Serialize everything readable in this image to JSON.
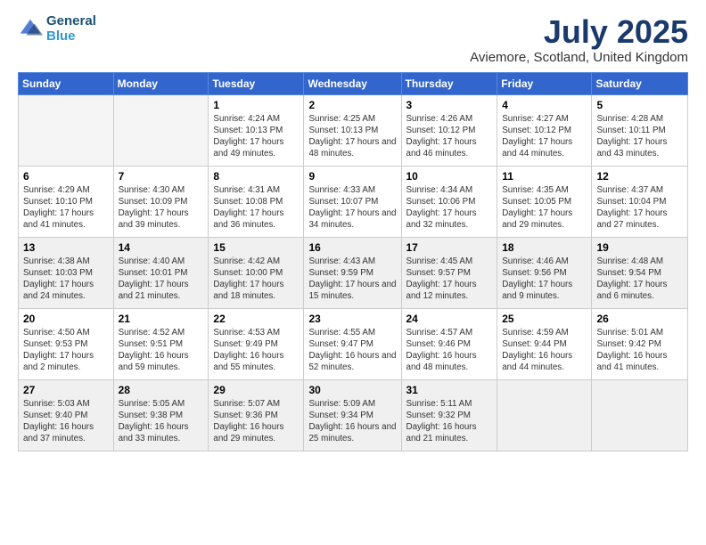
{
  "logo": {
    "line1": "General",
    "line2": "Blue"
  },
  "title": "July 2025",
  "location": "Aviemore, Scotland, United Kingdom",
  "days_of_week": [
    "Sunday",
    "Monday",
    "Tuesday",
    "Wednesday",
    "Thursday",
    "Friday",
    "Saturday"
  ],
  "weeks": [
    [
      {
        "day": "",
        "info": "",
        "empty": true
      },
      {
        "day": "",
        "info": "",
        "empty": true
      },
      {
        "day": "1",
        "info": "Sunrise: 4:24 AM\nSunset: 10:13 PM\nDaylight: 17 hours and 49 minutes."
      },
      {
        "day": "2",
        "info": "Sunrise: 4:25 AM\nSunset: 10:13 PM\nDaylight: 17 hours and 48 minutes."
      },
      {
        "day": "3",
        "info": "Sunrise: 4:26 AM\nSunset: 10:12 PM\nDaylight: 17 hours and 46 minutes."
      },
      {
        "day": "4",
        "info": "Sunrise: 4:27 AM\nSunset: 10:12 PM\nDaylight: 17 hours and 44 minutes."
      },
      {
        "day": "5",
        "info": "Sunrise: 4:28 AM\nSunset: 10:11 PM\nDaylight: 17 hours and 43 minutes."
      }
    ],
    [
      {
        "day": "6",
        "info": "Sunrise: 4:29 AM\nSunset: 10:10 PM\nDaylight: 17 hours and 41 minutes."
      },
      {
        "day": "7",
        "info": "Sunrise: 4:30 AM\nSunset: 10:09 PM\nDaylight: 17 hours and 39 minutes."
      },
      {
        "day": "8",
        "info": "Sunrise: 4:31 AM\nSunset: 10:08 PM\nDaylight: 17 hours and 36 minutes."
      },
      {
        "day": "9",
        "info": "Sunrise: 4:33 AM\nSunset: 10:07 PM\nDaylight: 17 hours and 34 minutes."
      },
      {
        "day": "10",
        "info": "Sunrise: 4:34 AM\nSunset: 10:06 PM\nDaylight: 17 hours and 32 minutes."
      },
      {
        "day": "11",
        "info": "Sunrise: 4:35 AM\nSunset: 10:05 PM\nDaylight: 17 hours and 29 minutes."
      },
      {
        "day": "12",
        "info": "Sunrise: 4:37 AM\nSunset: 10:04 PM\nDaylight: 17 hours and 27 minutes."
      }
    ],
    [
      {
        "day": "13",
        "info": "Sunrise: 4:38 AM\nSunset: 10:03 PM\nDaylight: 17 hours and 24 minutes.",
        "shaded": true
      },
      {
        "day": "14",
        "info": "Sunrise: 4:40 AM\nSunset: 10:01 PM\nDaylight: 17 hours and 21 minutes.",
        "shaded": true
      },
      {
        "day": "15",
        "info": "Sunrise: 4:42 AM\nSunset: 10:00 PM\nDaylight: 17 hours and 18 minutes.",
        "shaded": true
      },
      {
        "day": "16",
        "info": "Sunrise: 4:43 AM\nSunset: 9:59 PM\nDaylight: 17 hours and 15 minutes.",
        "shaded": true
      },
      {
        "day": "17",
        "info": "Sunrise: 4:45 AM\nSunset: 9:57 PM\nDaylight: 17 hours and 12 minutes.",
        "shaded": true
      },
      {
        "day": "18",
        "info": "Sunrise: 4:46 AM\nSunset: 9:56 PM\nDaylight: 17 hours and 9 minutes.",
        "shaded": true
      },
      {
        "day": "19",
        "info": "Sunrise: 4:48 AM\nSunset: 9:54 PM\nDaylight: 17 hours and 6 minutes.",
        "shaded": true
      }
    ],
    [
      {
        "day": "20",
        "info": "Sunrise: 4:50 AM\nSunset: 9:53 PM\nDaylight: 17 hours and 2 minutes."
      },
      {
        "day": "21",
        "info": "Sunrise: 4:52 AM\nSunset: 9:51 PM\nDaylight: 16 hours and 59 minutes."
      },
      {
        "day": "22",
        "info": "Sunrise: 4:53 AM\nSunset: 9:49 PM\nDaylight: 16 hours and 55 minutes."
      },
      {
        "day": "23",
        "info": "Sunrise: 4:55 AM\nSunset: 9:47 PM\nDaylight: 16 hours and 52 minutes."
      },
      {
        "day": "24",
        "info": "Sunrise: 4:57 AM\nSunset: 9:46 PM\nDaylight: 16 hours and 48 minutes."
      },
      {
        "day": "25",
        "info": "Sunrise: 4:59 AM\nSunset: 9:44 PM\nDaylight: 16 hours and 44 minutes."
      },
      {
        "day": "26",
        "info": "Sunrise: 5:01 AM\nSunset: 9:42 PM\nDaylight: 16 hours and 41 minutes."
      }
    ],
    [
      {
        "day": "27",
        "info": "Sunrise: 5:03 AM\nSunset: 9:40 PM\nDaylight: 16 hours and 37 minutes.",
        "shaded": true
      },
      {
        "day": "28",
        "info": "Sunrise: 5:05 AM\nSunset: 9:38 PM\nDaylight: 16 hours and 33 minutes.",
        "shaded": true
      },
      {
        "day": "29",
        "info": "Sunrise: 5:07 AM\nSunset: 9:36 PM\nDaylight: 16 hours and 29 minutes.",
        "shaded": true
      },
      {
        "day": "30",
        "info": "Sunrise: 5:09 AM\nSunset: 9:34 PM\nDaylight: 16 hours and 25 minutes.",
        "shaded": true
      },
      {
        "day": "31",
        "info": "Sunrise: 5:11 AM\nSunset: 9:32 PM\nDaylight: 16 hours and 21 minutes.",
        "shaded": true
      },
      {
        "day": "",
        "info": "",
        "empty": true,
        "shaded": true
      },
      {
        "day": "",
        "info": "",
        "empty": true,
        "shaded": true
      }
    ]
  ]
}
